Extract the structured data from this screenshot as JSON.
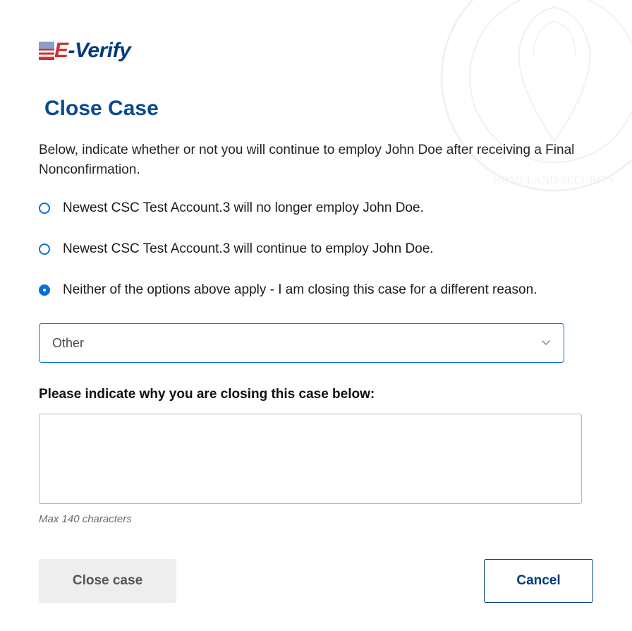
{
  "logo": {
    "prefix": "E",
    "suffix": "-Verify"
  },
  "page_title": "Close Case",
  "instruction": "Below, indicate whether or not you will continue to employ John Doe after receiving a Final Nonconfirmation.",
  "options": {
    "0": {
      "label": "Newest CSC Test Account.3 will no longer employ John Doe.",
      "selected": false
    },
    "1": {
      "label": "Newest CSC Test Account.3 will continue to employ John Doe.",
      "selected": false
    },
    "2": {
      "label": "Neither of the options above apply - I am closing this case for a different reason.",
      "selected": true
    }
  },
  "reason_select": {
    "value": "Other"
  },
  "reason_text": {
    "label": "Please indicate why you are closing this case below:",
    "value": "",
    "helper": "Max 140 characters"
  },
  "buttons": {
    "close_case": "Close case",
    "cancel": "Cancel"
  }
}
